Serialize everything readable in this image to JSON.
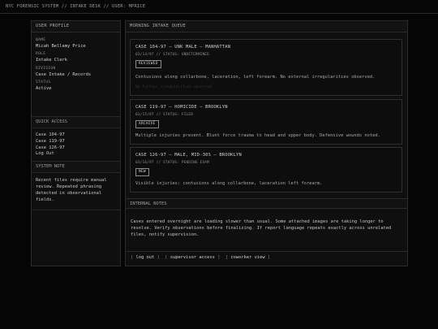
{
  "topbar": {
    "title": "NYC FORENSIC SYSTEM // INTAKE DESK // USER: MPRICE"
  },
  "left": {
    "header": "USER PROFILE",
    "profile": [
      {
        "label": "NAME",
        "value": "Micah Bellamy Price"
      },
      {
        "label": "ROLE",
        "value": "Intake Clerk"
      },
      {
        "label": "DIVISION",
        "value": "Case Intake / Records"
      },
      {
        "label": "STATUS",
        "value": "Active"
      }
    ],
    "quick_access_header": "QUICK ACCESS",
    "quick_access": [
      "Case 104-97",
      "Case 119-97",
      "Case 126-97",
      "Log Out"
    ],
    "system_note_header": "SYSTEM NOTE",
    "system_note": "Recent files require manual review. Repeated phrasing detected in observational fields."
  },
  "main": {
    "header": "MORNING INTAKE QUEUE",
    "cases": [
      {
        "title": "CASE 104-97 — UNK MALE — MANHATTAN",
        "meta": "03/14/97 // STATUS: UNDETERMINED",
        "badge": "REVIEWED",
        "body": "Contusions along collarbone, laceration, left forearm. No external irregularities observed.",
        "faint": "No further irregularities observed."
      },
      {
        "title": "CASE 119-97 — HOMICIDE — BROOKLYN",
        "meta": "03/15/97 // STATUS: FILED",
        "badge": "ARCHIVE",
        "body": "Multiple injuries present. Blunt force trauma to head and upper body. Defensive wounds noted."
      },
      {
        "title": "CASE 126-97 — MALE, MID-30S — BROOKLYN",
        "meta": "03/16/97 // STATUS: PENDING EXAM",
        "badge": "NEW",
        "body": "Visible injuries: contusions along collarbone, laceration left forearm."
      }
    ],
    "notes_header": "INTERNAL NOTES",
    "notes_text": "Cases entered overnight are loading slower than usual. Some attached images are taking longer to resolve. Verify observations before finalizing. If report language repeats exactly across unrelated files, notify supervision.",
    "footer_links": [
      "log out",
      "supervisor access",
      "coworker view"
    ]
  }
}
